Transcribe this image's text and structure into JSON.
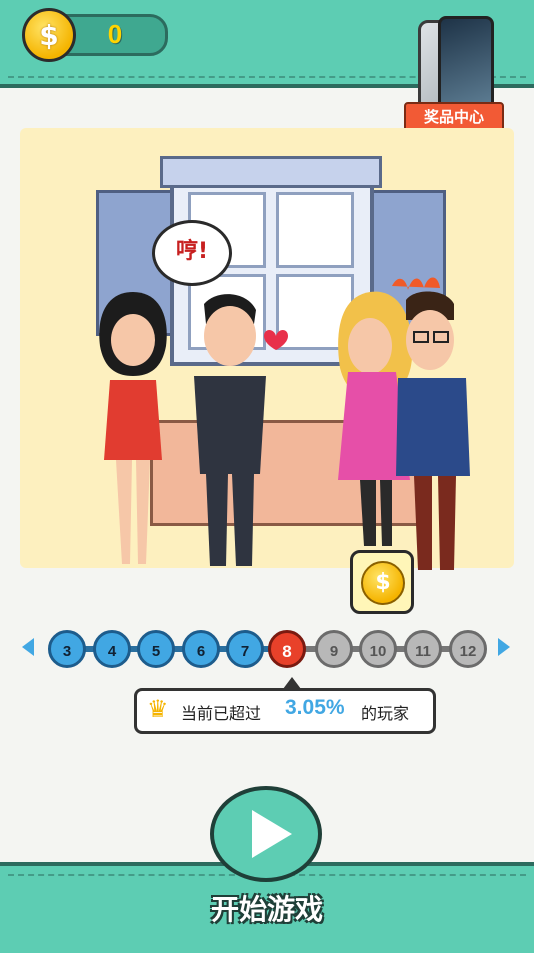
{
  "coins": {
    "count": "0",
    "icon": "dollar-coin-icon"
  },
  "prize_center": {
    "label": "奖品中心",
    "icon": "phone-prize-icon"
  },
  "scene": {
    "speech_bubble": "哼!",
    "floating_coin": "coin-reward-icon"
  },
  "levels": {
    "items": [
      {
        "num": "3",
        "state": "done"
      },
      {
        "num": "4",
        "state": "done"
      },
      {
        "num": "5",
        "state": "done"
      },
      {
        "num": "6",
        "state": "done"
      },
      {
        "num": "7",
        "state": "done"
      },
      {
        "num": "8",
        "state": "current"
      },
      {
        "num": "9",
        "state": "locked"
      },
      {
        "num": "10",
        "state": "locked"
      },
      {
        "num": "11",
        "state": "locked"
      },
      {
        "num": "12",
        "state": "locked"
      }
    ]
  },
  "rank": {
    "prefix": "当前已超过",
    "percent": "3.05%",
    "suffix": "的玩家"
  },
  "start": {
    "label": "开始游戏"
  },
  "colors": {
    "teal": "#5dcdb3",
    "level_done": "#41a7e3",
    "level_current": "#e8412a",
    "level_locked": "#b8b8b8"
  }
}
